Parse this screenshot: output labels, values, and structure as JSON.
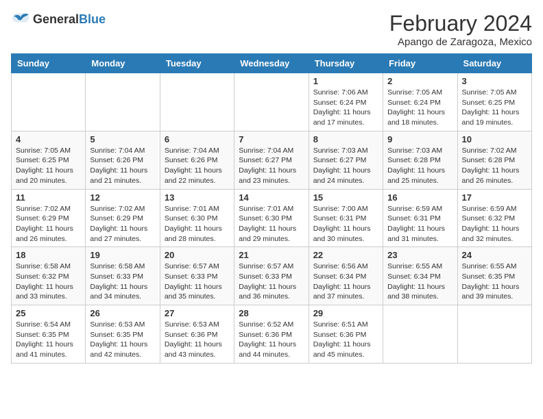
{
  "header": {
    "logo": {
      "general": "General",
      "blue": "Blue"
    },
    "title": "February 2024",
    "subtitle": "Apango de Zaragoza, Mexico"
  },
  "weekdays": [
    "Sunday",
    "Monday",
    "Tuesday",
    "Wednesday",
    "Thursday",
    "Friday",
    "Saturday"
  ],
  "weeks": [
    [
      {
        "day": "",
        "info": ""
      },
      {
        "day": "",
        "info": ""
      },
      {
        "day": "",
        "info": ""
      },
      {
        "day": "",
        "info": ""
      },
      {
        "day": "1",
        "info": "Sunrise: 7:06 AM\nSunset: 6:24 PM\nDaylight: 11 hours and 17 minutes."
      },
      {
        "day": "2",
        "info": "Sunrise: 7:05 AM\nSunset: 6:24 PM\nDaylight: 11 hours and 18 minutes."
      },
      {
        "day": "3",
        "info": "Sunrise: 7:05 AM\nSunset: 6:25 PM\nDaylight: 11 hours and 19 minutes."
      }
    ],
    [
      {
        "day": "4",
        "info": "Sunrise: 7:05 AM\nSunset: 6:25 PM\nDaylight: 11 hours and 20 minutes."
      },
      {
        "day": "5",
        "info": "Sunrise: 7:04 AM\nSunset: 6:26 PM\nDaylight: 11 hours and 21 minutes."
      },
      {
        "day": "6",
        "info": "Sunrise: 7:04 AM\nSunset: 6:26 PM\nDaylight: 11 hours and 22 minutes."
      },
      {
        "day": "7",
        "info": "Sunrise: 7:04 AM\nSunset: 6:27 PM\nDaylight: 11 hours and 23 minutes."
      },
      {
        "day": "8",
        "info": "Sunrise: 7:03 AM\nSunset: 6:27 PM\nDaylight: 11 hours and 24 minutes."
      },
      {
        "day": "9",
        "info": "Sunrise: 7:03 AM\nSunset: 6:28 PM\nDaylight: 11 hours and 25 minutes."
      },
      {
        "day": "10",
        "info": "Sunrise: 7:02 AM\nSunset: 6:28 PM\nDaylight: 11 hours and 26 minutes."
      }
    ],
    [
      {
        "day": "11",
        "info": "Sunrise: 7:02 AM\nSunset: 6:29 PM\nDaylight: 11 hours and 26 minutes."
      },
      {
        "day": "12",
        "info": "Sunrise: 7:02 AM\nSunset: 6:29 PM\nDaylight: 11 hours and 27 minutes."
      },
      {
        "day": "13",
        "info": "Sunrise: 7:01 AM\nSunset: 6:30 PM\nDaylight: 11 hours and 28 minutes."
      },
      {
        "day": "14",
        "info": "Sunrise: 7:01 AM\nSunset: 6:30 PM\nDaylight: 11 hours and 29 minutes."
      },
      {
        "day": "15",
        "info": "Sunrise: 7:00 AM\nSunset: 6:31 PM\nDaylight: 11 hours and 30 minutes."
      },
      {
        "day": "16",
        "info": "Sunrise: 6:59 AM\nSunset: 6:31 PM\nDaylight: 11 hours and 31 minutes."
      },
      {
        "day": "17",
        "info": "Sunrise: 6:59 AM\nSunset: 6:32 PM\nDaylight: 11 hours and 32 minutes."
      }
    ],
    [
      {
        "day": "18",
        "info": "Sunrise: 6:58 AM\nSunset: 6:32 PM\nDaylight: 11 hours and 33 minutes."
      },
      {
        "day": "19",
        "info": "Sunrise: 6:58 AM\nSunset: 6:33 PM\nDaylight: 11 hours and 34 minutes."
      },
      {
        "day": "20",
        "info": "Sunrise: 6:57 AM\nSunset: 6:33 PM\nDaylight: 11 hours and 35 minutes."
      },
      {
        "day": "21",
        "info": "Sunrise: 6:57 AM\nSunset: 6:33 PM\nDaylight: 11 hours and 36 minutes."
      },
      {
        "day": "22",
        "info": "Sunrise: 6:56 AM\nSunset: 6:34 PM\nDaylight: 11 hours and 37 minutes."
      },
      {
        "day": "23",
        "info": "Sunrise: 6:55 AM\nSunset: 6:34 PM\nDaylight: 11 hours and 38 minutes."
      },
      {
        "day": "24",
        "info": "Sunrise: 6:55 AM\nSunset: 6:35 PM\nDaylight: 11 hours and 39 minutes."
      }
    ],
    [
      {
        "day": "25",
        "info": "Sunrise: 6:54 AM\nSunset: 6:35 PM\nDaylight: 11 hours and 41 minutes."
      },
      {
        "day": "26",
        "info": "Sunrise: 6:53 AM\nSunset: 6:35 PM\nDaylight: 11 hours and 42 minutes."
      },
      {
        "day": "27",
        "info": "Sunrise: 6:53 AM\nSunset: 6:36 PM\nDaylight: 11 hours and 43 minutes."
      },
      {
        "day": "28",
        "info": "Sunrise: 6:52 AM\nSunset: 6:36 PM\nDaylight: 11 hours and 44 minutes."
      },
      {
        "day": "29",
        "info": "Sunrise: 6:51 AM\nSunset: 6:36 PM\nDaylight: 11 hours and 45 minutes."
      },
      {
        "day": "",
        "info": ""
      },
      {
        "day": "",
        "info": ""
      }
    ]
  ]
}
